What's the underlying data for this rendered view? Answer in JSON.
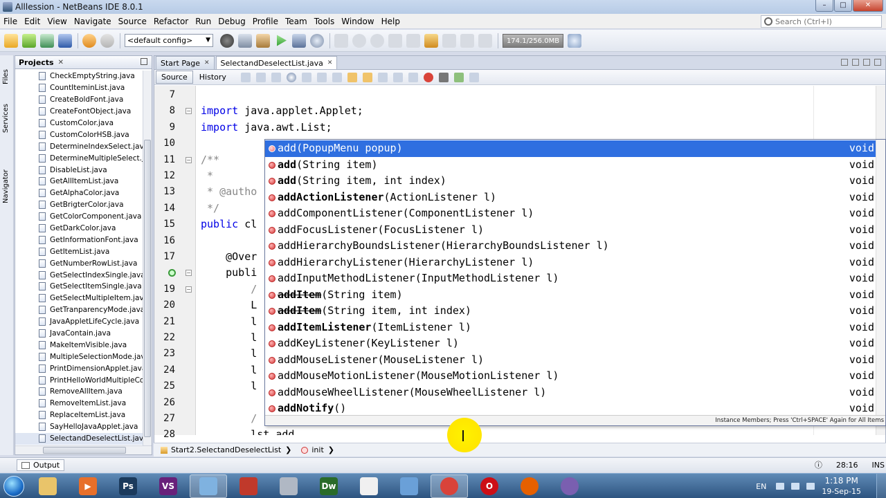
{
  "window": {
    "title": "Alllession - NetBeans IDE 8.0.1"
  },
  "menu": [
    "File",
    "Edit",
    "View",
    "Navigate",
    "Source",
    "Refactor",
    "Run",
    "Debug",
    "Profile",
    "Team",
    "Tools",
    "Window",
    "Help"
  ],
  "search": {
    "placeholder": "Search (Ctrl+I)"
  },
  "toolbar": {
    "config": "<default config>",
    "memory": "174.1/256.0MB",
    "icons": [
      "new-project-icon",
      "new-file-icon",
      "open-project-icon",
      "save-all-icon",
      "undo-icon",
      "redo-icon",
      "build-icon",
      "clean-build-icon",
      "run-icon",
      "debug-icon",
      "profile-icon",
      "pause-icon",
      "stop-icon",
      "step-icon",
      "gc-icon"
    ]
  },
  "left_strip": {
    "tabs": [
      "Files",
      "Services",
      "Navigator"
    ]
  },
  "projects": {
    "title": "Projects",
    "files": [
      "CheckEmptyString.java",
      "CountIteminList.java",
      "CreateBoldFont.java",
      "CreateFontObject.java",
      "CustomColor.java",
      "CustomColorHSB.java",
      "DetermineIndexSelect.java",
      "DetermineMultipleSelect.jav",
      "DisableList.java",
      "GetAllItemList.java",
      "GetAlphaColor.java",
      "GetBrigterColor.java",
      "GetColorComponent.java",
      "GetDarkColor.java",
      "GetInformationFont.java",
      "GetItemList.java",
      "GetNumberRowList.java",
      "GetSelectIndexSingle.java",
      "GetSelectItemSingle.java",
      "GetSelectMultipleItem.java",
      "GetTranparencyMode.java",
      "JavaAppletLifeCycle.java",
      "JavaContain.java",
      "MakeItemVisible.java",
      "MultipleSelectionMode.java",
      "PrintDimensionApplet.java",
      "PrintHelloWorldMultipleColor",
      "RemoveAllItem.java",
      "RemoveItemList.java",
      "ReplaceItemList.java",
      "SayHelloJavaApplet.java",
      "SelectandDeselectList.java"
    ],
    "selected_index": 31
  },
  "editor": {
    "tabs": [
      "Start Page",
      "SelectandDeselectList.java"
    ],
    "source_label": "Source",
    "history_label": "History",
    "lines": [
      {
        "n": "7",
        "text": ""
      },
      {
        "n": "8",
        "text": "import java.applet.Applet;"
      },
      {
        "n": "9",
        "text": "import java.awt.List;"
      },
      {
        "n": "10",
        "text": ""
      },
      {
        "n": "11",
        "text": "/**"
      },
      {
        "n": "12",
        "text": " *"
      },
      {
        "n": "13",
        "text": " * @autho"
      },
      {
        "n": "14",
        "text": " */"
      },
      {
        "n": "15",
        "text": "public cl"
      },
      {
        "n": "16",
        "text": ""
      },
      {
        "n": "17",
        "text": "    @Over"
      },
      {
        "n": "",
        "text": "    publi"
      },
      {
        "n": "19",
        "text": "        /"
      },
      {
        "n": "20",
        "text": "        L"
      },
      {
        "n": "21",
        "text": "        l"
      },
      {
        "n": "22",
        "text": "        l"
      },
      {
        "n": "23",
        "text": "        l"
      },
      {
        "n": "24",
        "text": "        l"
      },
      {
        "n": "25",
        "text": "        l"
      },
      {
        "n": "26",
        "text": ""
      },
      {
        "n": "27",
        "text": "        /"
      },
      {
        "n": "28",
        "text": "        lst.add"
      }
    ]
  },
  "completion": {
    "items": [
      {
        "name": "add",
        "params": "(PopupMenu popup)",
        "bold": false,
        "strike": false
      },
      {
        "name": "add",
        "params": "(String item)",
        "bold": true,
        "strike": false
      },
      {
        "name": "add",
        "params": "(String item, int index)",
        "bold": true,
        "strike": false
      },
      {
        "name": "addActionListener",
        "params": "(ActionListener l)",
        "bold": true,
        "strike": false
      },
      {
        "name": "addComponentListener",
        "params": "(ComponentListener l)",
        "bold": false,
        "strike": false
      },
      {
        "name": "addFocusListener",
        "params": "(FocusListener l)",
        "bold": false,
        "strike": false
      },
      {
        "name": "addHierarchyBoundsListener",
        "params": "(HierarchyBoundsListener l)",
        "bold": false,
        "strike": false
      },
      {
        "name": "addHierarchyListener",
        "params": "(HierarchyListener l)",
        "bold": false,
        "strike": false
      },
      {
        "name": "addInputMethodListener",
        "params": "(InputMethodListener l)",
        "bold": false,
        "strike": false
      },
      {
        "name": "addItem",
        "params": "(String item)",
        "bold": true,
        "strike": true
      },
      {
        "name": "addItem",
        "params": "(String item, int index)",
        "bold": true,
        "strike": true
      },
      {
        "name": "addItemListener",
        "params": "(ItemListener l)",
        "bold": true,
        "strike": false
      },
      {
        "name": "addKeyListener",
        "params": "(KeyListener l)",
        "bold": false,
        "strike": false
      },
      {
        "name": "addMouseListener",
        "params": "(MouseListener l)",
        "bold": false,
        "strike": false
      },
      {
        "name": "addMouseMotionListener",
        "params": "(MouseMotionListener l)",
        "bold": false,
        "strike": false
      },
      {
        "name": "addMouseWheelListener",
        "params": "(MouseWheelListener l)",
        "bold": false,
        "strike": false
      },
      {
        "name": "addNotify",
        "params": "()",
        "bold": true,
        "strike": false
      }
    ],
    "return_type": "void",
    "selected_index": 0,
    "hint": "Instance Members; Press 'Ctrl+SPACE' Again for All Items"
  },
  "breadcrumbs": [
    "Start2.SelectandDeselectList",
    "init"
  ],
  "output": {
    "label": "Output"
  },
  "status": {
    "position": "28:16",
    "mode": "INS"
  },
  "taskbar": {
    "apps": [
      {
        "name": "explorer",
        "glyph": "",
        "color": "#e9c46a"
      },
      {
        "name": "media-player",
        "glyph": "▶",
        "color": "#e76f2a"
      },
      {
        "name": "photoshop",
        "glyph": "Ps",
        "color": "#1b3a5c"
      },
      {
        "name": "visual-studio",
        "glyph": "VS",
        "color": "#68217a"
      },
      {
        "name": "netbeans",
        "glyph": "",
        "color": "#7fb2e0",
        "active": true
      },
      {
        "name": "tool",
        "glyph": "",
        "color": "#c0392b"
      },
      {
        "name": "tools",
        "glyph": "",
        "color": "#b0b8c4"
      },
      {
        "name": "dreamweaver",
        "glyph": "Dw",
        "color": "#2a6b2a"
      },
      {
        "name": "window",
        "glyph": "",
        "color": "#f0f0f0"
      },
      {
        "name": "network",
        "glyph": "",
        "color": "#6aa0d8"
      },
      {
        "name": "chrome",
        "glyph": "",
        "color": "#d9433a",
        "active": true
      },
      {
        "name": "opera",
        "glyph": "O",
        "color": "#cc0f16"
      },
      {
        "name": "firefox",
        "glyph": "",
        "color": "#e66000"
      },
      {
        "name": "orb",
        "glyph": "",
        "color": "#7a5fb0"
      }
    ],
    "lang": "EN",
    "time": "1:18 PM",
    "date": "19-Sep-15"
  }
}
